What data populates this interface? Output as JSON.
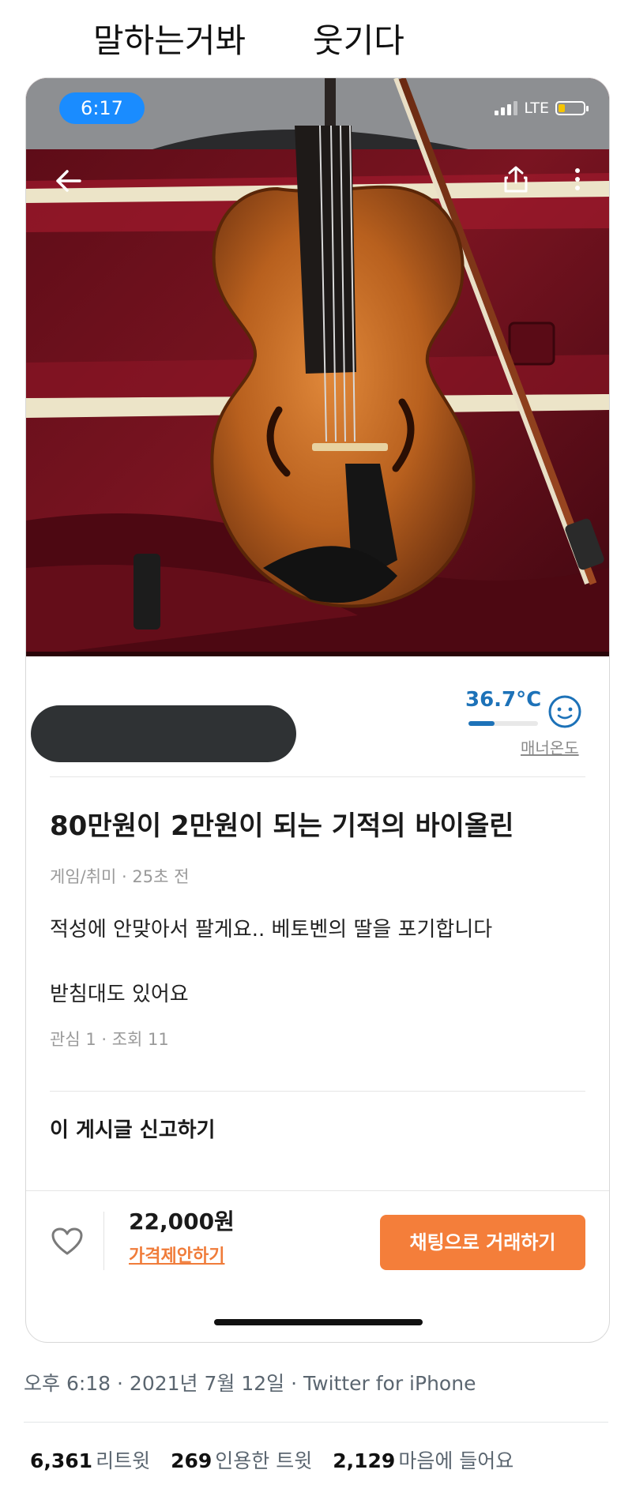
{
  "caption": {
    "left": "말하는거봐",
    "right": "웃기다"
  },
  "status_bar": {
    "time": "6:17",
    "network": "LTE"
  },
  "icons": {
    "back": "back-arrow-icon",
    "share": "share-icon",
    "more": "more-vertical-icon",
    "face": "smiley-face-icon",
    "heart": "heart-icon"
  },
  "seller": {
    "temperature": "36.7°C",
    "temperature_level": 0.37,
    "temperature_label": "매너온도"
  },
  "post": {
    "title": "80만원이 2만원이 되는 기적의 바이올린",
    "meta": "게임/취미 · 25초 전",
    "body_line1": "적성에 안맞아서 팔게요.. 베토벤의 딸을 포기합니다",
    "body_line2": "받침대도 있어요",
    "stats": "관심 1 · 조회 11",
    "report": "이 게시글 신고하기"
  },
  "bottom": {
    "price": "22,000원",
    "offer": "가격제안하기",
    "chat": "채팅으로 거래하기"
  },
  "tweet": {
    "meta": "오후 6:18 · 2021년 7월 12일 · Twitter for iPhone",
    "retweets_count": "6,361",
    "retweets_label": "리트윗",
    "quotes_count": "269",
    "quotes_label": "인용한 트윗",
    "likes_count": "2,129",
    "likes_label": "마음에 들어요"
  },
  "colors": {
    "accent_orange": "#f47e3a",
    "temperature_blue": "#1d72b8",
    "status_time_bg": "#1a8cff",
    "battery_yellow": "#f5c400"
  }
}
